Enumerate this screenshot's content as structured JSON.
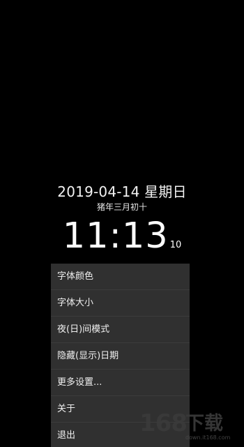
{
  "clock": {
    "date": "2019-04-14 星期日",
    "lunar": "猪年三月初十",
    "time": "11:13",
    "seconds": "10"
  },
  "menu": {
    "items": [
      {
        "label": "字体颜色"
      },
      {
        "label": "字体大小"
      },
      {
        "label": "夜(日)间模式"
      },
      {
        "label": "隐藏(显示)日期"
      },
      {
        "label": "更多设置..."
      },
      {
        "label": "关于"
      },
      {
        "label": "退出"
      }
    ]
  },
  "watermark": {
    "number": "168",
    "text": "下载",
    "url": "down.it168.com"
  },
  "colors": {
    "background": "#000000",
    "menu_background": "#303030",
    "text": "#ffffff"
  }
}
